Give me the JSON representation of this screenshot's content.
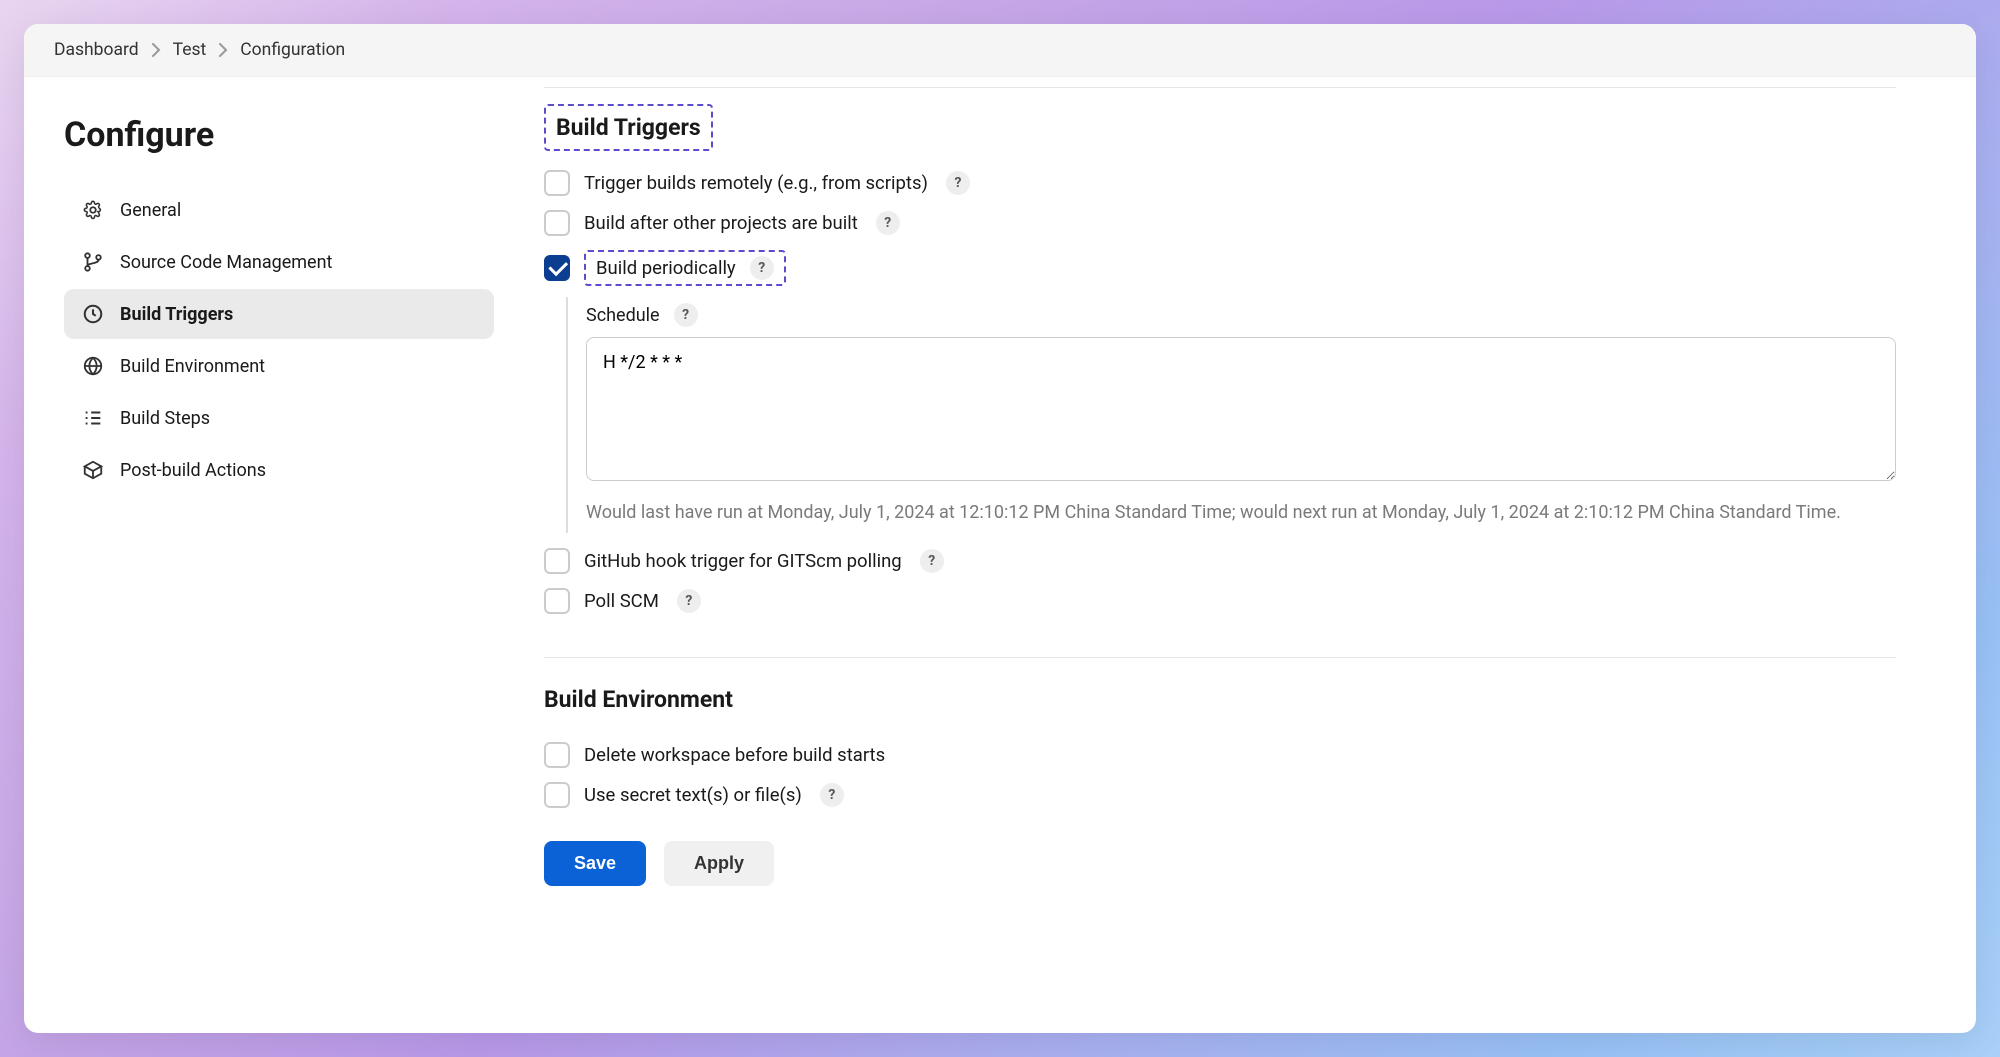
{
  "breadcrumbs": [
    "Dashboard",
    "Test",
    "Configuration"
  ],
  "sidebar": {
    "title": "Configure",
    "items": [
      {
        "icon": "gear",
        "label": "General"
      },
      {
        "icon": "branch",
        "label": "Source Code Management"
      },
      {
        "icon": "clock",
        "label": "Build Triggers",
        "active": true
      },
      {
        "icon": "globe",
        "label": "Build Environment"
      },
      {
        "icon": "steps",
        "label": "Build Steps"
      },
      {
        "icon": "box-arrow",
        "label": "Post-build Actions"
      }
    ]
  },
  "build_triggers": {
    "title": "Build Triggers",
    "options": {
      "remote": {
        "label": "Trigger builds remotely (e.g., from scripts)",
        "checked": false
      },
      "after_other": {
        "label": "Build after other projects are built",
        "checked": false
      },
      "periodic": {
        "label": "Build periodically",
        "checked": true
      },
      "github_hook": {
        "label": "GitHub hook trigger for GITScm polling",
        "checked": false
      },
      "poll_scm": {
        "label": "Poll SCM",
        "checked": false
      }
    },
    "schedule": {
      "label": "Schedule",
      "value": "H */2 * * *",
      "hint": "Would last have run at Monday, July 1, 2024 at 12:10:12 PM China Standard Time; would next run at Monday, July 1, 2024 at 2:10:12 PM China Standard Time."
    }
  },
  "build_environment": {
    "title": "Build Environment",
    "options": {
      "delete_ws": {
        "label": "Delete workspace before build starts",
        "checked": false
      },
      "use_secret": {
        "label": "Use secret text(s) or file(s)",
        "checked": false
      }
    }
  },
  "actions": {
    "save": "Save",
    "apply": "Apply"
  }
}
